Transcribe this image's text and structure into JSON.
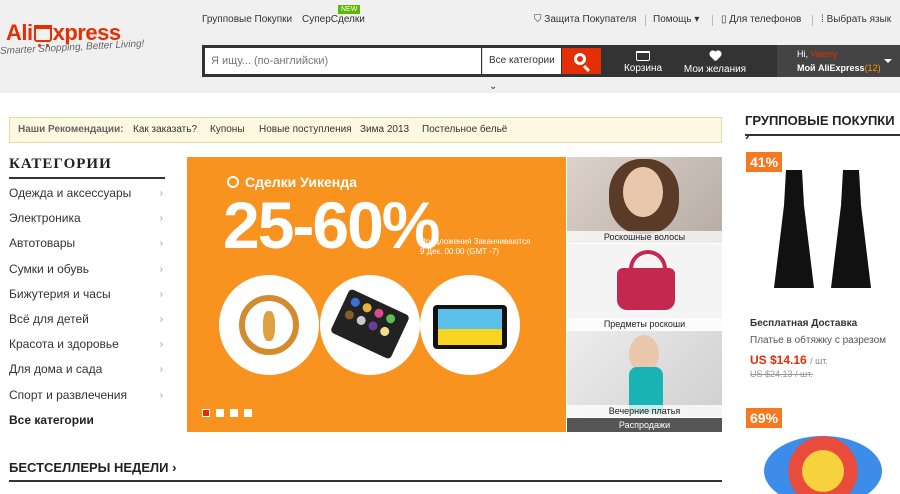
{
  "header": {
    "logo_ali": "Ali",
    "logo_xpress": "xpress",
    "slogan": "Smarter Shopping, Better Living!",
    "nav_group_buy": "Групповые Покупки",
    "nav_super": "СуперСделки",
    "new_badge": "NEW",
    "nav_protect": "Защита Покупателя",
    "nav_help": "Помощь",
    "nav_phones": "Для телефонов",
    "nav_lang": "Выбрать язык",
    "search_placeholder": "Я ищу... (по-английски)",
    "search_category": "Все категории",
    "cart_label": "Корзина",
    "wishlist_label": "Мои желания",
    "user_greeting": "Hi,",
    "user_name": "Valeriy",
    "my_account": "Мой AliExpress",
    "my_account_count": "(12)"
  },
  "recommendations": {
    "label": "Наши Рекомендации:",
    "links": [
      "Как заказать?",
      "Купоны",
      "Новые поступления",
      "Зима 2013",
      "Постельное бельё"
    ]
  },
  "categories": {
    "title": "КАТЕГОРИИ",
    "items": [
      "Одежда и аксессуары",
      "Электроника",
      "Автотовары",
      "Сумки и обувь",
      "Бижутерия и часы",
      "Всё для детей",
      "Красота и здоровье",
      "Для дома и сада",
      "Спорт и развлечения"
    ],
    "all": "Все категории"
  },
  "banner": {
    "deals": "Сделки Уикенда",
    "percent": "25-60%",
    "note_line1": "Предложения Заканчиваются",
    "note_line2": "9 Дек. 00:00 (GMT -7)"
  },
  "promos": {
    "p1": "Роскошные волосы",
    "p2": "Предметы роскоши",
    "p3": "Вечерние платья",
    "sales": "Распродажи"
  },
  "bestsellers": {
    "title": "БЕСТСЕЛЛЕРЫ НЕДЕЛИ"
  },
  "group_buy": {
    "title": "ГРУППОВЫЕ ПОКУПКИ",
    "item1": {
      "discount": "41%",
      "shipping": "Бесплатная Доставка",
      "name": "Платье в обтяжку с разрезом",
      "price": "US $14.16",
      "unit": "/ шт.",
      "old_price": "US $24.13 / шт."
    },
    "item2": {
      "discount": "69%"
    }
  },
  "colors": {
    "brand": "#e62e04",
    "banner": "#f7931e",
    "discount": "#f47920"
  }
}
